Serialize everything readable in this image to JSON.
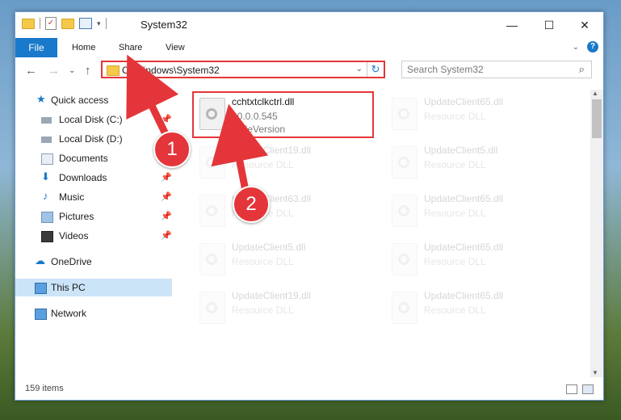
{
  "window": {
    "title": "System32",
    "controls": {
      "minimize": "—",
      "maximize": "☐",
      "close": "✕"
    }
  },
  "ribbon": {
    "tabs": [
      "File",
      "Home",
      "Share",
      "View"
    ]
  },
  "navigation": {
    "address_path": "C:\\Windows\\System32",
    "search_placeholder": "Search System32"
  },
  "sidebar": {
    "items": [
      {
        "label": "Quick access",
        "icon": "star-icon"
      },
      {
        "label": "Local Disk (C:)",
        "icon": "drive-icon",
        "pinned": true
      },
      {
        "label": "Local Disk (D:)",
        "icon": "drive-icon",
        "pinned": true
      },
      {
        "label": "Documents",
        "icon": "documents-icon",
        "pinned": true
      },
      {
        "label": "Downloads",
        "icon": "downloads-icon",
        "pinned": true
      },
      {
        "label": "Music",
        "icon": "music-icon",
        "pinned": true
      },
      {
        "label": "Pictures",
        "icon": "pictures-icon",
        "pinned": true
      },
      {
        "label": "Videos",
        "icon": "videos-icon",
        "pinned": true
      },
      {
        "label": "OneDrive",
        "icon": "cloud-icon"
      },
      {
        "label": "This PC",
        "icon": "pc-icon",
        "selected": true
      },
      {
        "label": "Network",
        "icon": "network-icon"
      }
    ]
  },
  "files": [
    {
      "name": "cchtxtclkctrl.dll",
      "line2": "10.0.0.545",
      "line3": "6FileVersion",
      "faded": false
    },
    {
      "name": "UpdateClient65.dll",
      "line2": "Resource DLL",
      "faded": true
    },
    {
      "name": "UpdateClient19.dll",
      "line2": "Resource DLL",
      "faded": true
    },
    {
      "name": "UpdateClient5.dll",
      "line2": "Resource DLL",
      "faded": true
    },
    {
      "name": "UpdateClient63.dll",
      "line2": "Resource DLL",
      "faded": true
    },
    {
      "name": "UpdateClient65.dll",
      "line2": "Resource DLL",
      "faded": true
    },
    {
      "name": "UpdateClient5.dll",
      "line2": "Resource DLL",
      "faded": true
    },
    {
      "name": "UpdateClient65.dll",
      "line2": "Resource DLL",
      "faded": true
    },
    {
      "name": "UpdateClient19.dll",
      "line2": "Resource DLL",
      "faded": true
    },
    {
      "name": "UpdateClient65.dll",
      "line2": "Resource DLL",
      "faded": true
    }
  ],
  "status": {
    "item_count": "159 items"
  },
  "annotations": {
    "step1": "1",
    "step2": "2",
    "accent": "#e4363a"
  }
}
